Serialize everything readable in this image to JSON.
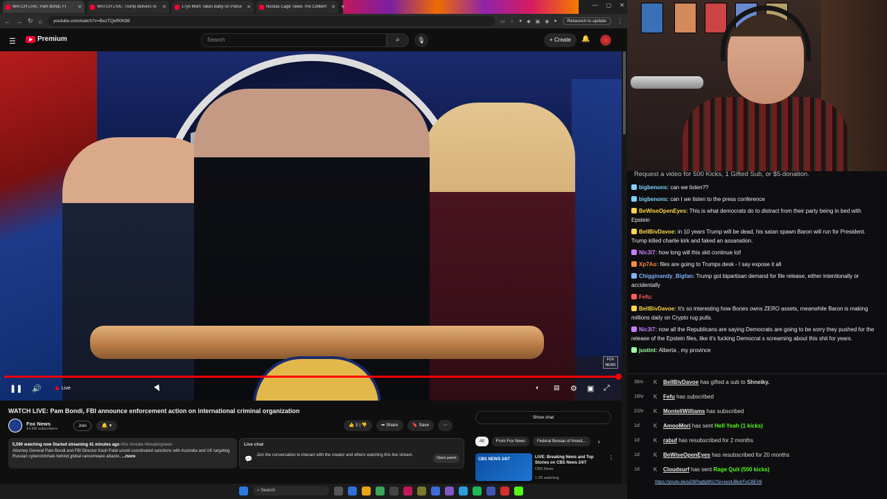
{
  "browser": {
    "tabs": [
      {
        "title": "WATCH LIVE: Pam Bondi, FI",
        "active": true
      },
      {
        "title": "WATCH LIVE: Trump delivers re",
        "active": false
      },
      {
        "title": "17yo Mom Takes Baby on Police",
        "active": false
      },
      {
        "title": "Nicolas Cage Takes The Collbert",
        "active": false
      }
    ],
    "url": "youtube.com/watch?v=BezTQeR0K88",
    "relaunch_label": "Relaunch to update"
  },
  "youtube": {
    "brand": "Premium",
    "search_placeholder": "Search",
    "create_label": "Create",
    "live_label": "Live",
    "video_title": "WATCH LIVE: Pam Bondi, FBI announce enforcement action on international criminal organization",
    "channel_name": "Fox News",
    "subscribers": "14.6M subscribers",
    "join_label": "Join",
    "likes": "3",
    "share_label": "Share",
    "save_label": "Save",
    "description": {
      "meta": "5,590 watching now  Started streaming 41 minutes ago",
      "tags": "#fox #media #breakingnews",
      "text": "Attorney General Pam Bondi and FBI Director Kash Patel unveil coordinated sanctions with Australia and UK targeting Russian cybercriminals behind global ransomware attacks.",
      "more": "...more"
    },
    "live_chat": {
      "title": "Live chat",
      "body": "Join the conversation to interact with the creator and others watching this live stream.",
      "open_panel": "Open panel"
    },
    "show_chat": "Show chat",
    "chips": [
      "All",
      "From Fox News",
      "Federal Bureau of Invest..."
    ],
    "recommended": {
      "thumb_label": "CBS NEWS 24/7",
      "title": "LIVE: Breaking News and Top Stories on CBS News 24/7",
      "channel": "CBS News",
      "watching": "1.2K watching"
    }
  },
  "taskbar": {
    "search_label": "Search"
  },
  "chat": {
    "banner": "Request a video for 500 Kicks, 1 Gifted Sub, or $5 donation.",
    "messages": [
      {
        "user": "bigbenons:",
        "text": " can we listen??",
        "color": "#7fd3ff"
      },
      {
        "user": "bigbenons:",
        "text": " can I we listen to the press conference",
        "color": "#7fd3ff"
      },
      {
        "user": "BeWiseOpenEyes:",
        "text": " This is what democrats do to distract from their party being in bed with Epstein",
        "color": "#ffd54a"
      },
      {
        "user": "BellBivDavoe:",
        "text": " in 10 years Trump will be dead, his satan spawn Baron will run for President. Trump killed charlie kirk and faked an assanation.",
        "color": "#ffd54a"
      },
      {
        "user": "Nic3l7:",
        "text": " how long will this skit continue lol!",
        "color": "#c77dff"
      },
      {
        "user": "Xp7Ao:",
        "text": " files are going to Trumps desk - I say expose it all",
        "color": "#ff8a3d"
      },
      {
        "user": "Chigginandy_Bigfan:",
        "text": " Trump got bipartisan demand for file release, either intentionally or accidentally",
        "color": "#7fb2ff"
      },
      {
        "user": "Fefu:",
        "text": "",
        "color": "#ff5c5c"
      },
      {
        "user": "BellBivDavoe:",
        "text": " It's so interesting how Bones owns ZERO assets, meanwhile Baron is making millions daily on Crypto rug pulls.",
        "color": "#ffd54a"
      },
      {
        "user": "Nic3l7:",
        "text": " now all the Republicans are saying Democrats are going to be sorry they pushed for the release of the Epstein files, like it's fucking Democrat s screaming about this shit for years.",
        "color": "#c77dff"
      },
      {
        "user": "justint:",
        "text": " Alberta , my province",
        "color": "#9effa3"
      }
    ]
  },
  "events": [
    {
      "time": "36m",
      "name": "BellBivDavoe",
      "text": " has gifted a sub to ",
      "extra": "Shneiky.",
      "highlight": ""
    },
    {
      "time": "16hr",
      "name": "Fefu",
      "text": " has subscribed",
      "extra": "",
      "highlight": ""
    },
    {
      "time": "21hr",
      "name": "MontellWilliams",
      "text": " has subscribed",
      "extra": "",
      "highlight": ""
    },
    {
      "time": "1d",
      "name": "AmooMori",
      "text": " has sent ",
      "extra": "",
      "highlight": "Hell Yeah (1 kicks)"
    },
    {
      "time": "1d",
      "name": "rabuf",
      "text": " has resubscribed for 2 months",
      "extra": "",
      "highlight": ""
    },
    {
      "time": "1d",
      "name": "BeWiseOpenEyes",
      "text": " has resubscribed for 20 months",
      "extra": "",
      "highlight": ""
    },
    {
      "time": "1d",
      "name": "Cloudsurf",
      "text": " has sent ",
      "extra": "",
      "highlight": "Rage Quit (500 kicks)"
    }
  ],
  "event_link": "https://youtu.be/uD9Pxgfq9KU?si=vuvtJBulrFoC8EV6",
  "colors": {
    "accent_red": "#ff0000",
    "kick_green": "#53fc18"
  }
}
